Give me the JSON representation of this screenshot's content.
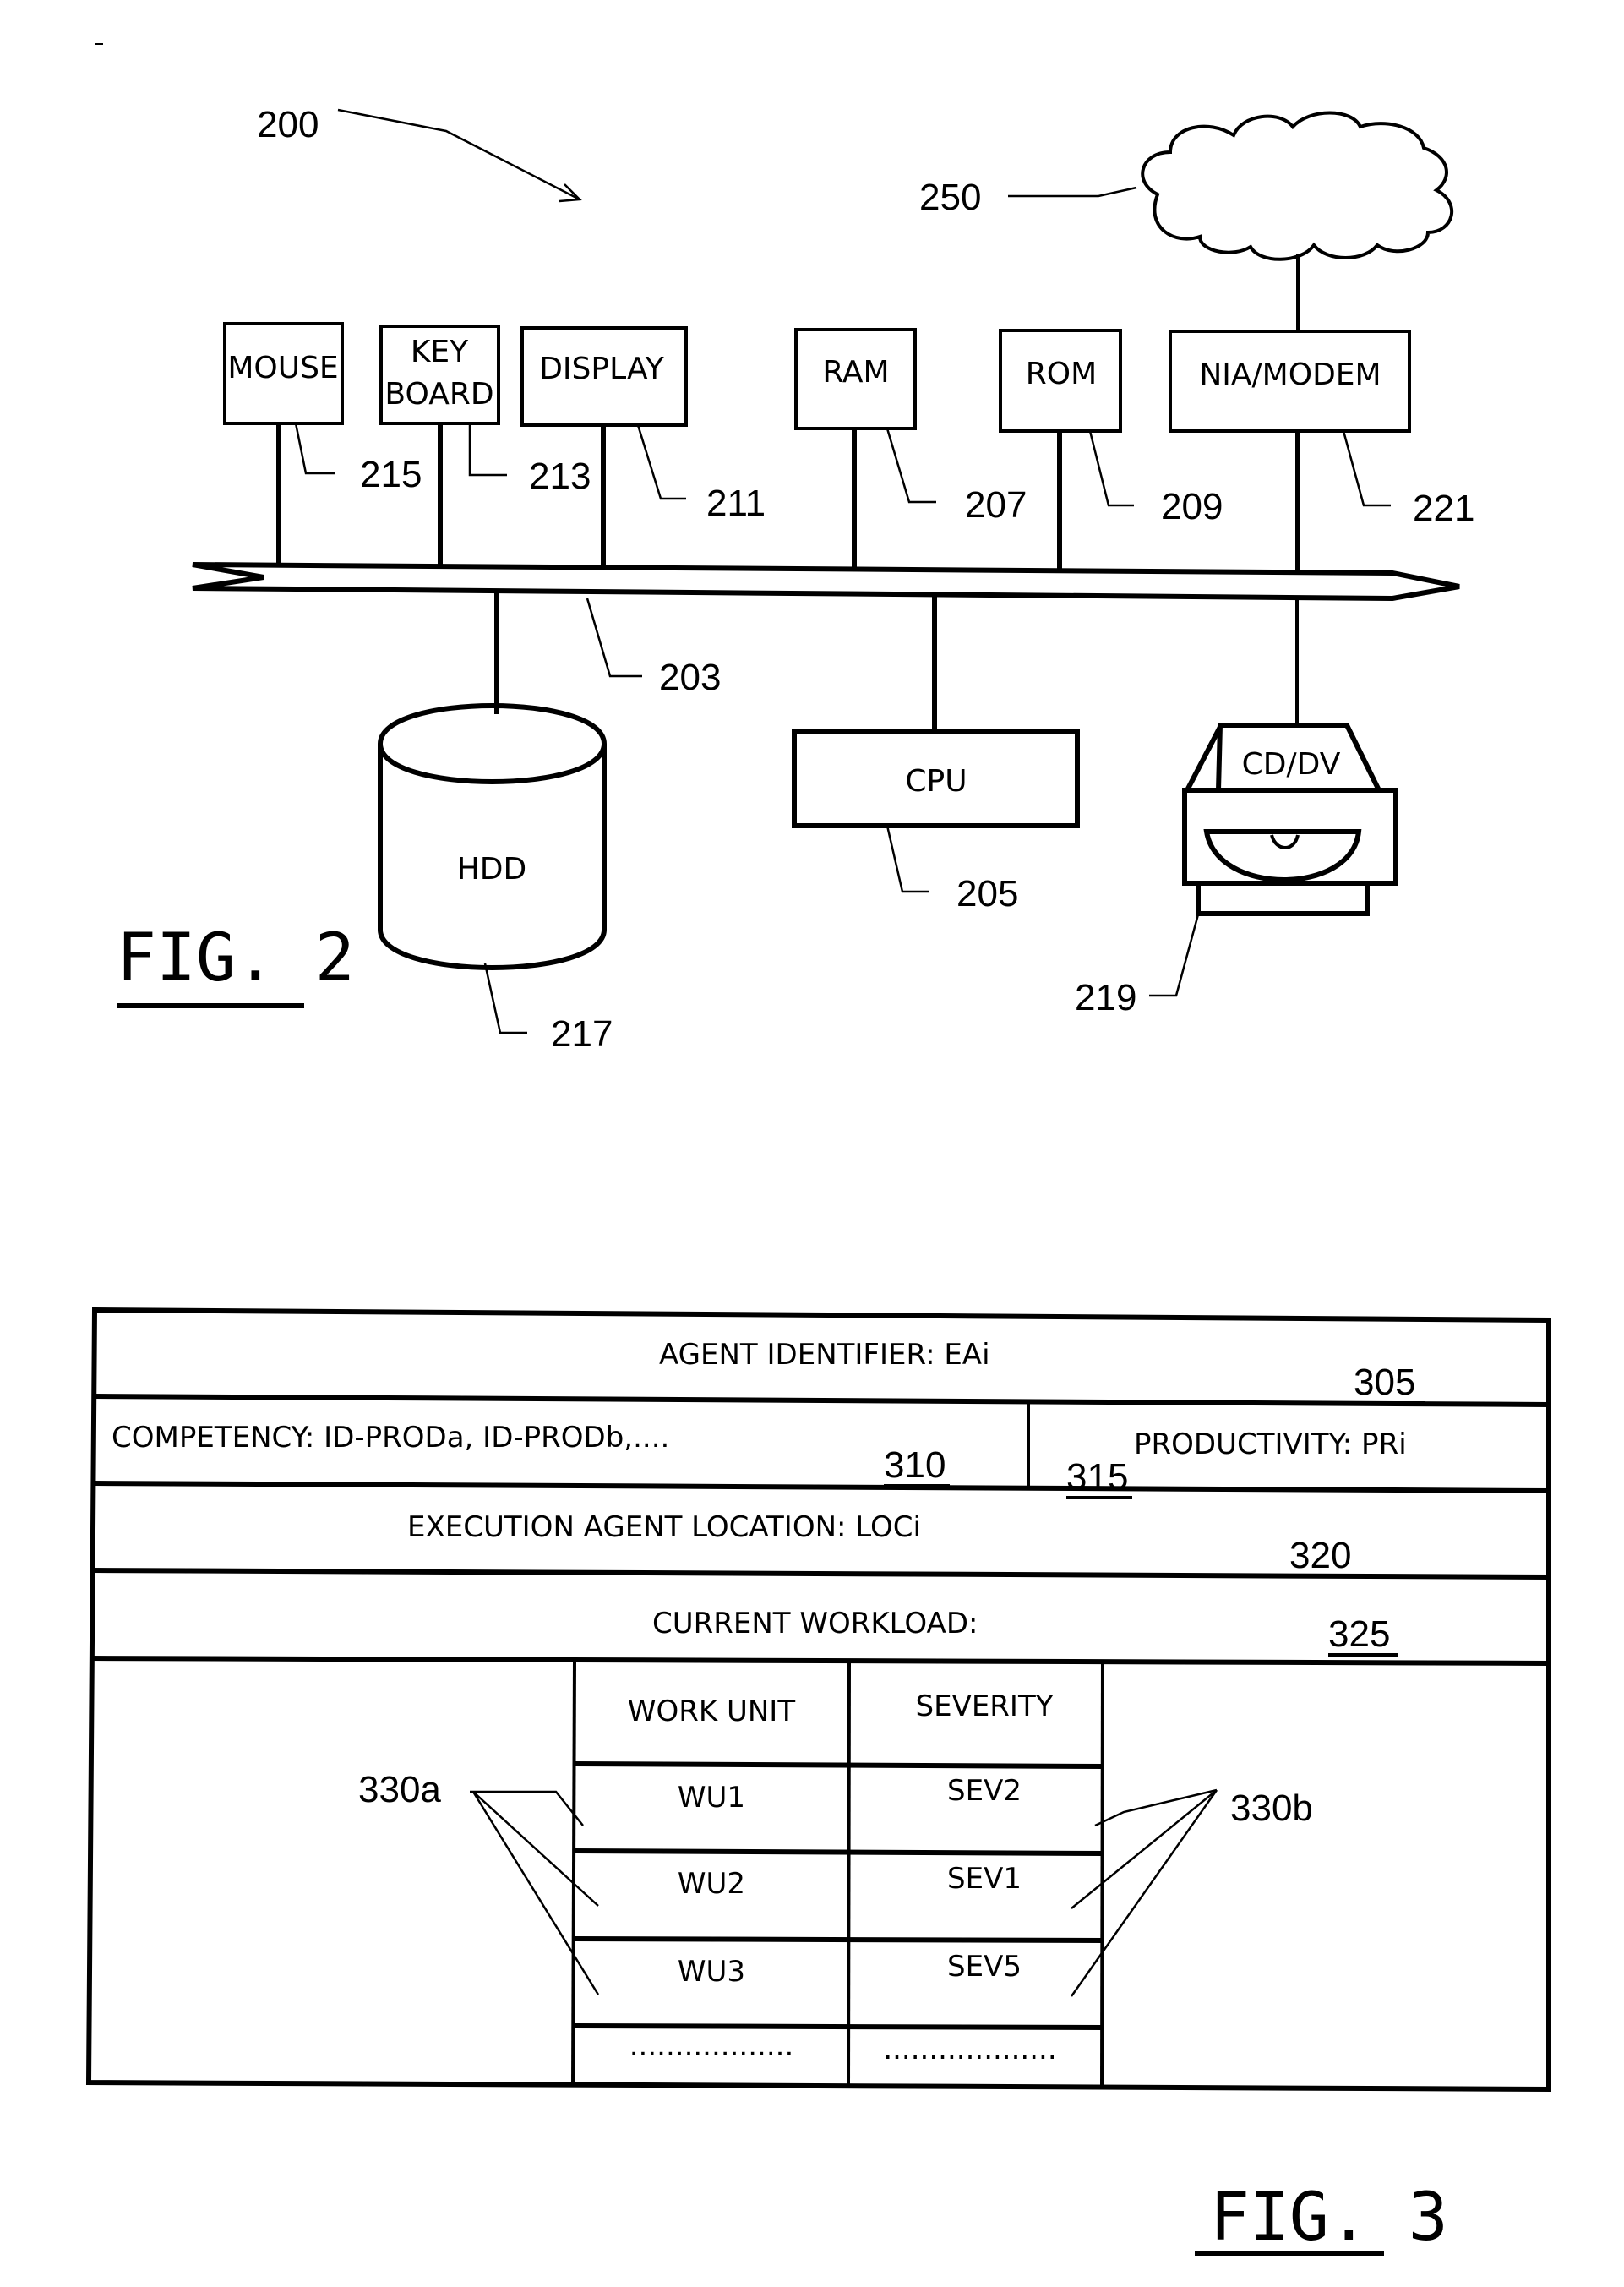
{
  "fig2": {
    "title": "FIG. 2",
    "system_ref": "200",
    "network": {
      "ref": "250",
      "icon": "cloud-icon"
    },
    "bus": {
      "ref": "203"
    },
    "components": [
      {
        "id": "mouse",
        "label_lines": [
          "MOUSE"
        ],
        "ref": "215"
      },
      {
        "id": "keyboard",
        "label_lines": [
          "KEY",
          "BOARD"
        ],
        "ref": "213"
      },
      {
        "id": "display",
        "label_lines": [
          "DISPLAY"
        ],
        "ref": "211"
      },
      {
        "id": "ram",
        "label_lines": [
          "RAM"
        ],
        "ref": "207"
      },
      {
        "id": "rom",
        "label_lines": [
          "ROM"
        ],
        "ref": "209"
      },
      {
        "id": "nia-modem",
        "label_lines": [
          "NIA/MODEM"
        ],
        "ref": "221"
      },
      {
        "id": "hdd",
        "label_lines": [
          "HDD"
        ],
        "ref": "217",
        "icon": "cylinder-icon"
      },
      {
        "id": "cpu",
        "label_lines": [
          "CPU"
        ],
        "ref": "205"
      },
      {
        "id": "cd-dvd",
        "label_lines": [
          "CD/DV"
        ],
        "ref": "219",
        "icon": "disc-drive-icon"
      }
    ]
  },
  "fig3": {
    "title": "FIG. 3",
    "rows": {
      "agent_identifier": {
        "text": "AGENT IDENTIFIER: EAi",
        "ref": "305"
      },
      "competency": {
        "text": "COMPETENCY: ID-PRODa, ID-PRODb,....",
        "ref": "310"
      },
      "productivity": {
        "text": "PRODUCTIVITY: PRi",
        "ref": "315"
      },
      "location": {
        "text": "EXECUTION AGENT LOCATION: LOCi",
        "ref": "320"
      },
      "workload": {
        "text": "CURRENT WORKLOAD:",
        "ref": "325"
      }
    },
    "workload_table": {
      "headers": [
        "WORK UNIT",
        "SEVERITY"
      ],
      "rows": [
        [
          "WU1",
          "SEV2"
        ],
        [
          "WU2",
          "SEV1"
        ],
        [
          "WU3",
          "SEV5"
        ],
        [
          "..................",
          "..................."
        ]
      ],
      "work_unit_ref": "330a",
      "severity_ref": "330b"
    }
  }
}
